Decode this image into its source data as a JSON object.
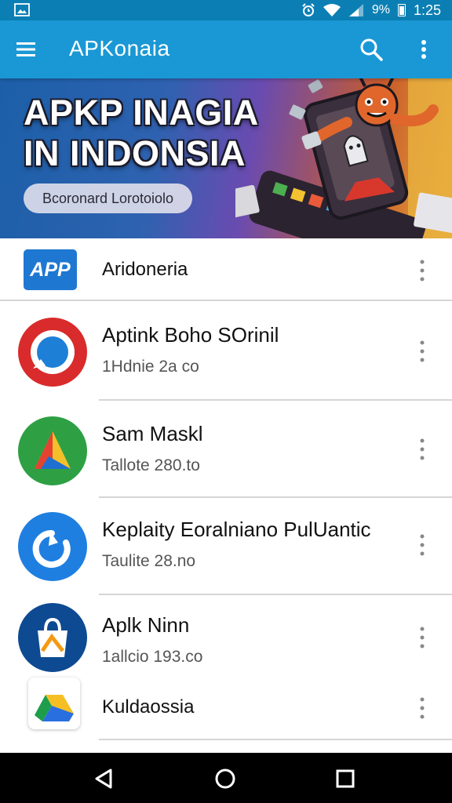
{
  "status_bar": {
    "battery_text": "9%",
    "time": "1:25",
    "icons": [
      "image-icon",
      "alarm-icon",
      "wifi-icon",
      "signal-icon",
      "battery-icon"
    ]
  },
  "app_bar": {
    "title": "APKonaia",
    "icons": [
      "menu-icon",
      "search-icon",
      "more-vert-icon"
    ]
  },
  "banner": {
    "title_line1": "APKP INAGIA",
    "title_line2": "IN INDONSIA",
    "pill_label": "Bcoronard Lorotoiolo",
    "art": "android-mascot-phone-illustration"
  },
  "list": {
    "items": [
      {
        "icon": "app-badge-icon",
        "icon_text": "APP",
        "title": "Aridoneria",
        "subtitle": ""
      },
      {
        "icon": "red-ring-app-icon",
        "title": "Aptink Boho SOrinil",
        "subtitle": "1Hdnie 2a co"
      },
      {
        "icon": "green-triangle-app-icon",
        "title": "Sam Maskl",
        "subtitle": "Tallote 280.to"
      },
      {
        "icon": "blue-swirl-app-icon",
        "title": "Keplaity Eoralniano PulUantic",
        "subtitle": "Taulite 28.no"
      },
      {
        "icon": "shopping-bag-app-icon",
        "title": "Aplk Ninn",
        "subtitle": "1allcio 193.co"
      },
      {
        "icon": "drive-triangle-app-icon",
        "title": "Kuldaossia",
        "subtitle": ""
      }
    ]
  },
  "nav_bar": {
    "icons": [
      "back-icon",
      "home-icon",
      "recents-icon"
    ]
  },
  "colors": {
    "status_bar": "#0b7fb4",
    "app_bar": "#1a98d5",
    "nav_bar": "#000000"
  }
}
